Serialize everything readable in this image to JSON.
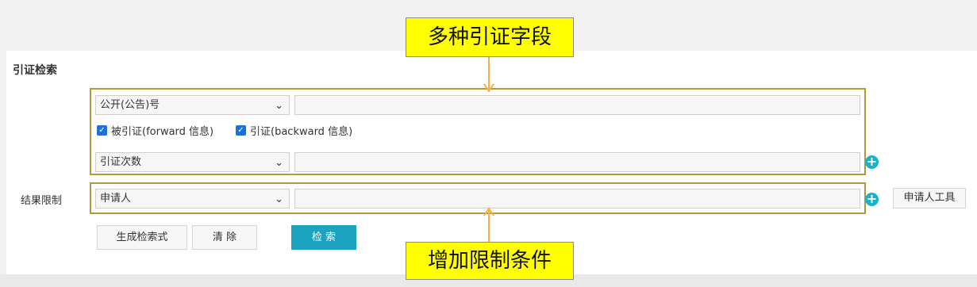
{
  "section_title": "引证检索",
  "citation_fields": {
    "field1_select": "公开(公告)号",
    "field1_value": "",
    "checkbox_forward_label": "被引证(forward 信息)",
    "checkbox_forward_checked": true,
    "checkbox_backward_label": "引证(backward 信息)",
    "checkbox_backward_checked": true,
    "field2_select": "引证次数",
    "field2_value": ""
  },
  "result_limit": {
    "label": "结果限制",
    "select": "申请人",
    "value": "",
    "tool_button": "申请人工具"
  },
  "actions": {
    "generate_label": "生成检索式",
    "clear_label": "清 除",
    "search_label": "检 索"
  },
  "annotations": {
    "top_callout": "多种引证字段",
    "bottom_callout": "增加限制条件"
  },
  "colors": {
    "primary_button": "#1ca3bf",
    "plus_icon": "#19b3c8",
    "checkbox": "#1e6fd9",
    "highlight_border": "#b8963c",
    "callout_bg": "#ffff00",
    "arrow": "#f5b041"
  }
}
